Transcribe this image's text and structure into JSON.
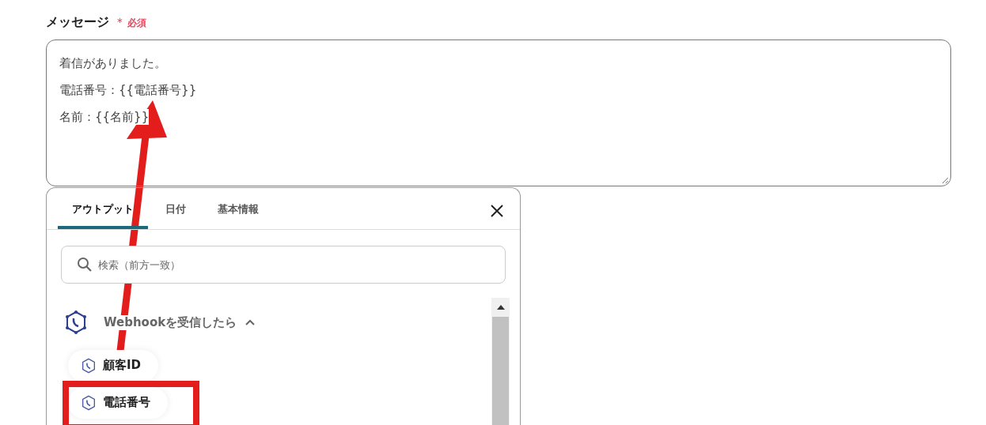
{
  "field": {
    "label": "メッセージ",
    "required_mark": "＊",
    "required_text": "必須",
    "lines": [
      "着信がありました。",
      "電話番号：{{電話番号}}",
      "名前：{{名前}}"
    ]
  },
  "popup": {
    "tabs": [
      {
        "label": "アウトプット",
        "selected": true
      },
      {
        "label": "日付",
        "selected": false
      },
      {
        "label": "基本情報",
        "selected": false
      }
    ],
    "search": {
      "placeholder": "検索（前方一致）"
    },
    "group": {
      "title": "Webhookを受信したら",
      "expanded": true,
      "items": [
        {
          "label": "顧客ID",
          "highlighted": false
        },
        {
          "label": "電話番号",
          "highlighted": true
        }
      ]
    }
  }
}
